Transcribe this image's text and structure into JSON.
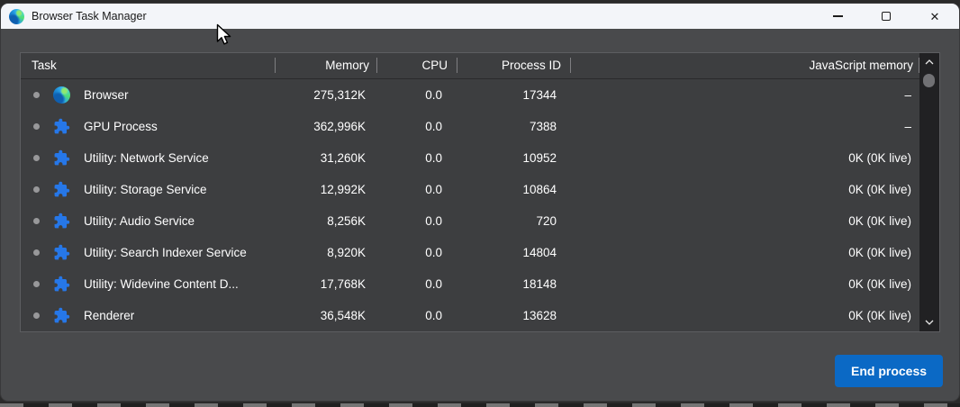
{
  "titlebar": {
    "title": "Browser Task Manager",
    "icons": {
      "app": "edge-logo",
      "minimize": "minimize",
      "maximize": "maximize",
      "close": "✕"
    }
  },
  "table": {
    "columns": [
      "Task",
      "Memory",
      "CPU",
      "Process ID",
      "JavaScript memory"
    ],
    "rows": [
      {
        "task": "Browser",
        "icon": "edge",
        "memory": "275,312K",
        "cpu": "0.0",
        "pid": "17344",
        "js": "–"
      },
      {
        "task": "GPU Process",
        "icon": "extension",
        "memory": "362,996K",
        "cpu": "0.0",
        "pid": "7388",
        "js": "–"
      },
      {
        "task": "Utility: Network Service",
        "icon": "extension",
        "memory": "31,260K",
        "cpu": "0.0",
        "pid": "10952",
        "js": "0K (0K live)"
      },
      {
        "task": "Utility: Storage Service",
        "icon": "extension",
        "memory": "12,992K",
        "cpu": "0.0",
        "pid": "10864",
        "js": "0K (0K live)"
      },
      {
        "task": "Utility: Audio Service",
        "icon": "extension",
        "memory": "8,256K",
        "cpu": "0.0",
        "pid": "720",
        "js": "0K (0K live)"
      },
      {
        "task": "Utility: Search Indexer Service",
        "icon": "extension",
        "memory": "8,920K",
        "cpu": "0.0",
        "pid": "14804",
        "js": "0K (0K live)"
      },
      {
        "task": "Utility: Widevine Content D...",
        "icon": "extension",
        "memory": "17,768K",
        "cpu": "0.0",
        "pid": "18148",
        "js": "0K (0K live)"
      },
      {
        "task": "Renderer",
        "icon": "extension",
        "memory": "36,548K",
        "cpu": "0.0",
        "pid": "13628",
        "js": "0K (0K live)"
      }
    ],
    "scrollbar_icons": {
      "up": "chevron-up",
      "down": "chevron-down"
    }
  },
  "footer": {
    "end_process_label": "End process"
  },
  "colors": {
    "button_blue": "#0b69c5",
    "titlebar_bg": "#f3f5f9",
    "window_bg": "#494a4c",
    "table_bg": "#3d3e40",
    "extension_blue": "#2677e8",
    "text": "#ffffff"
  }
}
